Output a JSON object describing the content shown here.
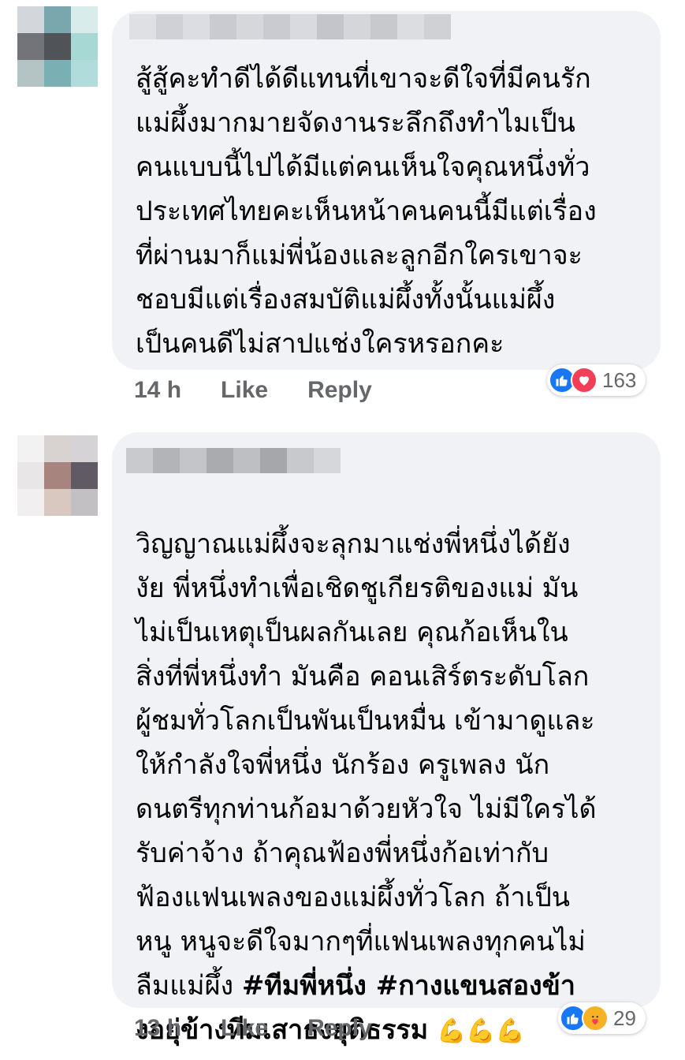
{
  "comments": [
    {
      "text": "สู้สู้คะทำดีได้ดีแทนที่เขาจะดีใจที่มีคนรัก\nแม่ผึ้งมากมายจัดงานระลึกถึงทำไมเป็น\nคนแบบนี้ไปได้มีแต่คนเห็นใจคุณหนึ่งทั่ว\nประเทศไทยคะเห็นหน้าคนคนนี้มีแต่เรื่อง\nที่ผ่านมาก็แม่พี่น้องและลูกอีกใครเขาจะ\nชอบมีแต่เรื่องสมบัติแม่ผึ้งทั้งนั้นแม่ผึ้ง\nเป็นคนดีไม่สาปแช่งใครหรอกคะ",
      "time": "14 h",
      "like_label": "Like",
      "reply_label": "Reply",
      "reactions": [
        "like-icon",
        "love-icon"
      ],
      "reaction_count": "163"
    },
    {
      "text": "วิญญาณแม่ผึ้งจะลุกมาแช่งพี่หนึ่งได้ยัง\nงัย พี่หนึ่งทำเพื่อเชิดชูเกียรติของแม่ มัน\nไม่เป็นเหตุเป็นผลกันเลย คุณก้อเห็นใน\nสิ่งที่พี่หนึ่งทำ มันคือ คอนเสิร์ตระดับโลก\nผู้ชมทั่วโลกเป็นพันเป็นหมื่น เข้ามาดูและ\nให้กำลังใจพี่หนึ่ง นักร้อง ครูเพลง นัก\nดนตรีทุกท่านก้อมาด้วยหัวใจ ไม่มีใครได้\nรับค่าจ้าง ถ้าคุณฟ้องพี่หนึ่งก้อเท่ากับ\nฟ้องแฟนเพลงของแม่ผึ้งทั่วโลก ถ้าเป็น\nหนู หนูจะดีใจมากๆที่แฟนเพลงทุกคนไม่\nลืมแม่ผึ้ง ",
      "hashtags": "#ทีมพี่หนึ่ง #กางแขนสองข้า\nงอยุ่ข้างทีมเสาธงยุติธรรม",
      "emoji": "💪💪💪",
      "time": "13 h",
      "like_label": "Like",
      "reply_label": "Reply",
      "reactions": [
        "like-icon",
        "care-icon"
      ],
      "reaction_count": "29"
    }
  ],
  "colors": {
    "bubble": "#f0f2f5",
    "meta_text": "#65676b",
    "like_blue": "#1877f2",
    "love_red": "#f33e58",
    "care_yellow": "#f7b125"
  }
}
